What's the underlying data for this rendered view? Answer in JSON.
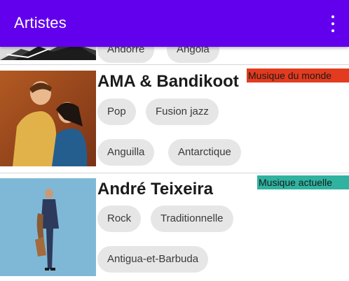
{
  "appbar": {
    "title": "Artistes",
    "menu_icon": "more-vert-icon",
    "color": "#6200ee"
  },
  "cards": [
    {
      "name": "",
      "badge": "",
      "chips_row1": [
        "Andorre",
        "Angola"
      ],
      "chips_row2": []
    },
    {
      "name": "AMA & Bandikoot",
      "badge": "Musique du monde",
      "badge_color": "#e23b1f",
      "chips_row1": [
        "Pop",
        "Fusion jazz"
      ],
      "chips_row2": [
        "Anguilla",
        "Antarctique"
      ]
    },
    {
      "name": "André Teixeira",
      "badge": "Musique actuelle",
      "badge_color": "#2fb3a0",
      "chips_row1": [
        "Rock",
        "Traditionnelle"
      ],
      "chips_row2": [
        "Antigua-et-Barbuda"
      ]
    }
  ]
}
